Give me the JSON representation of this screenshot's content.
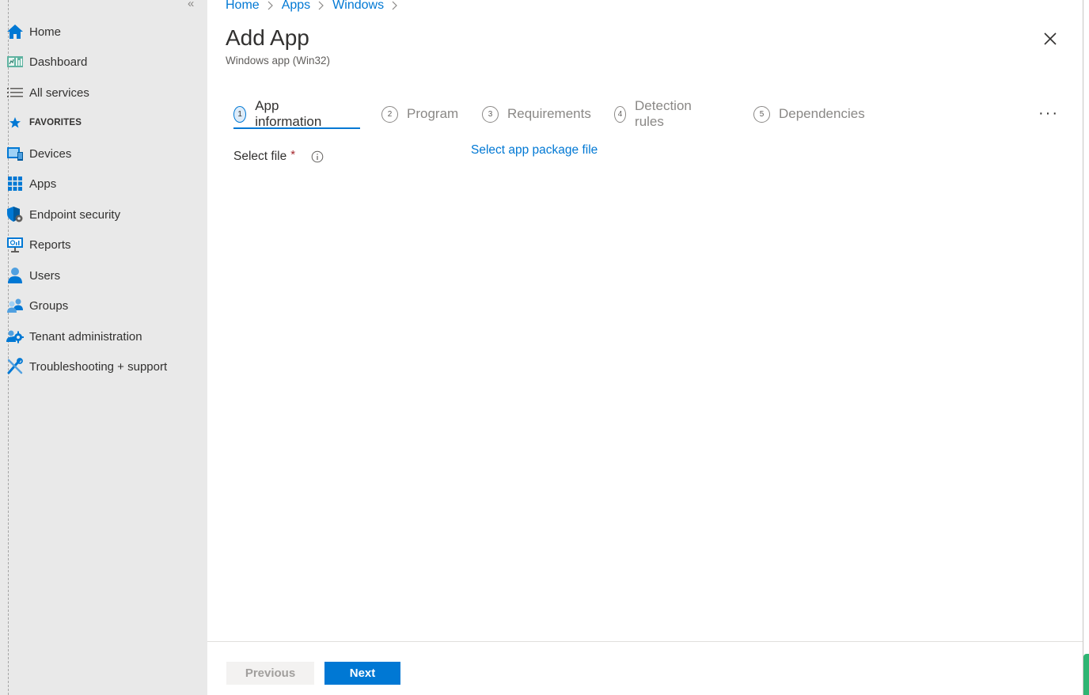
{
  "breadcrumb": [
    "Home",
    "Apps",
    "Windows"
  ],
  "page": {
    "title": "Add App",
    "subtitle": "Windows app (Win32)"
  },
  "sidebar": {
    "items": [
      {
        "label": "Home",
        "icon": "home-icon"
      },
      {
        "label": "Dashboard",
        "icon": "dashboard-icon"
      },
      {
        "label": "All services",
        "icon": "list-icon"
      },
      {
        "label": "FAVORITES",
        "icon": "star-icon"
      },
      {
        "label": "Devices",
        "icon": "devices-icon"
      },
      {
        "label": "Apps",
        "icon": "apps-grid-icon"
      },
      {
        "label": "Endpoint security",
        "icon": "shield-icon"
      },
      {
        "label": "Reports",
        "icon": "reports-icon"
      },
      {
        "label": "Users",
        "icon": "user-icon"
      },
      {
        "label": "Groups",
        "icon": "groups-icon"
      },
      {
        "label": "Tenant administration",
        "icon": "tenant-admin-icon"
      },
      {
        "label": "Troubleshooting + support",
        "icon": "tools-icon"
      }
    ]
  },
  "wizard": {
    "steps": [
      {
        "num": "1",
        "label": "App information",
        "active": true
      },
      {
        "num": "2",
        "label": "Program",
        "active": false
      },
      {
        "num": "3",
        "label": "Requirements",
        "active": false
      },
      {
        "num": "4",
        "label": "Detection rules",
        "active": false
      },
      {
        "num": "5",
        "label": "Dependencies",
        "active": false
      }
    ]
  },
  "form": {
    "select_file_label": "Select file",
    "required_mark": "*",
    "select_link": "Select app package file"
  },
  "footer": {
    "previous": "Previous",
    "next": "Next"
  },
  "colors": {
    "accent": "#0078d4",
    "sidebar_bg": "#e9e9e9",
    "required": "#a4262c"
  }
}
